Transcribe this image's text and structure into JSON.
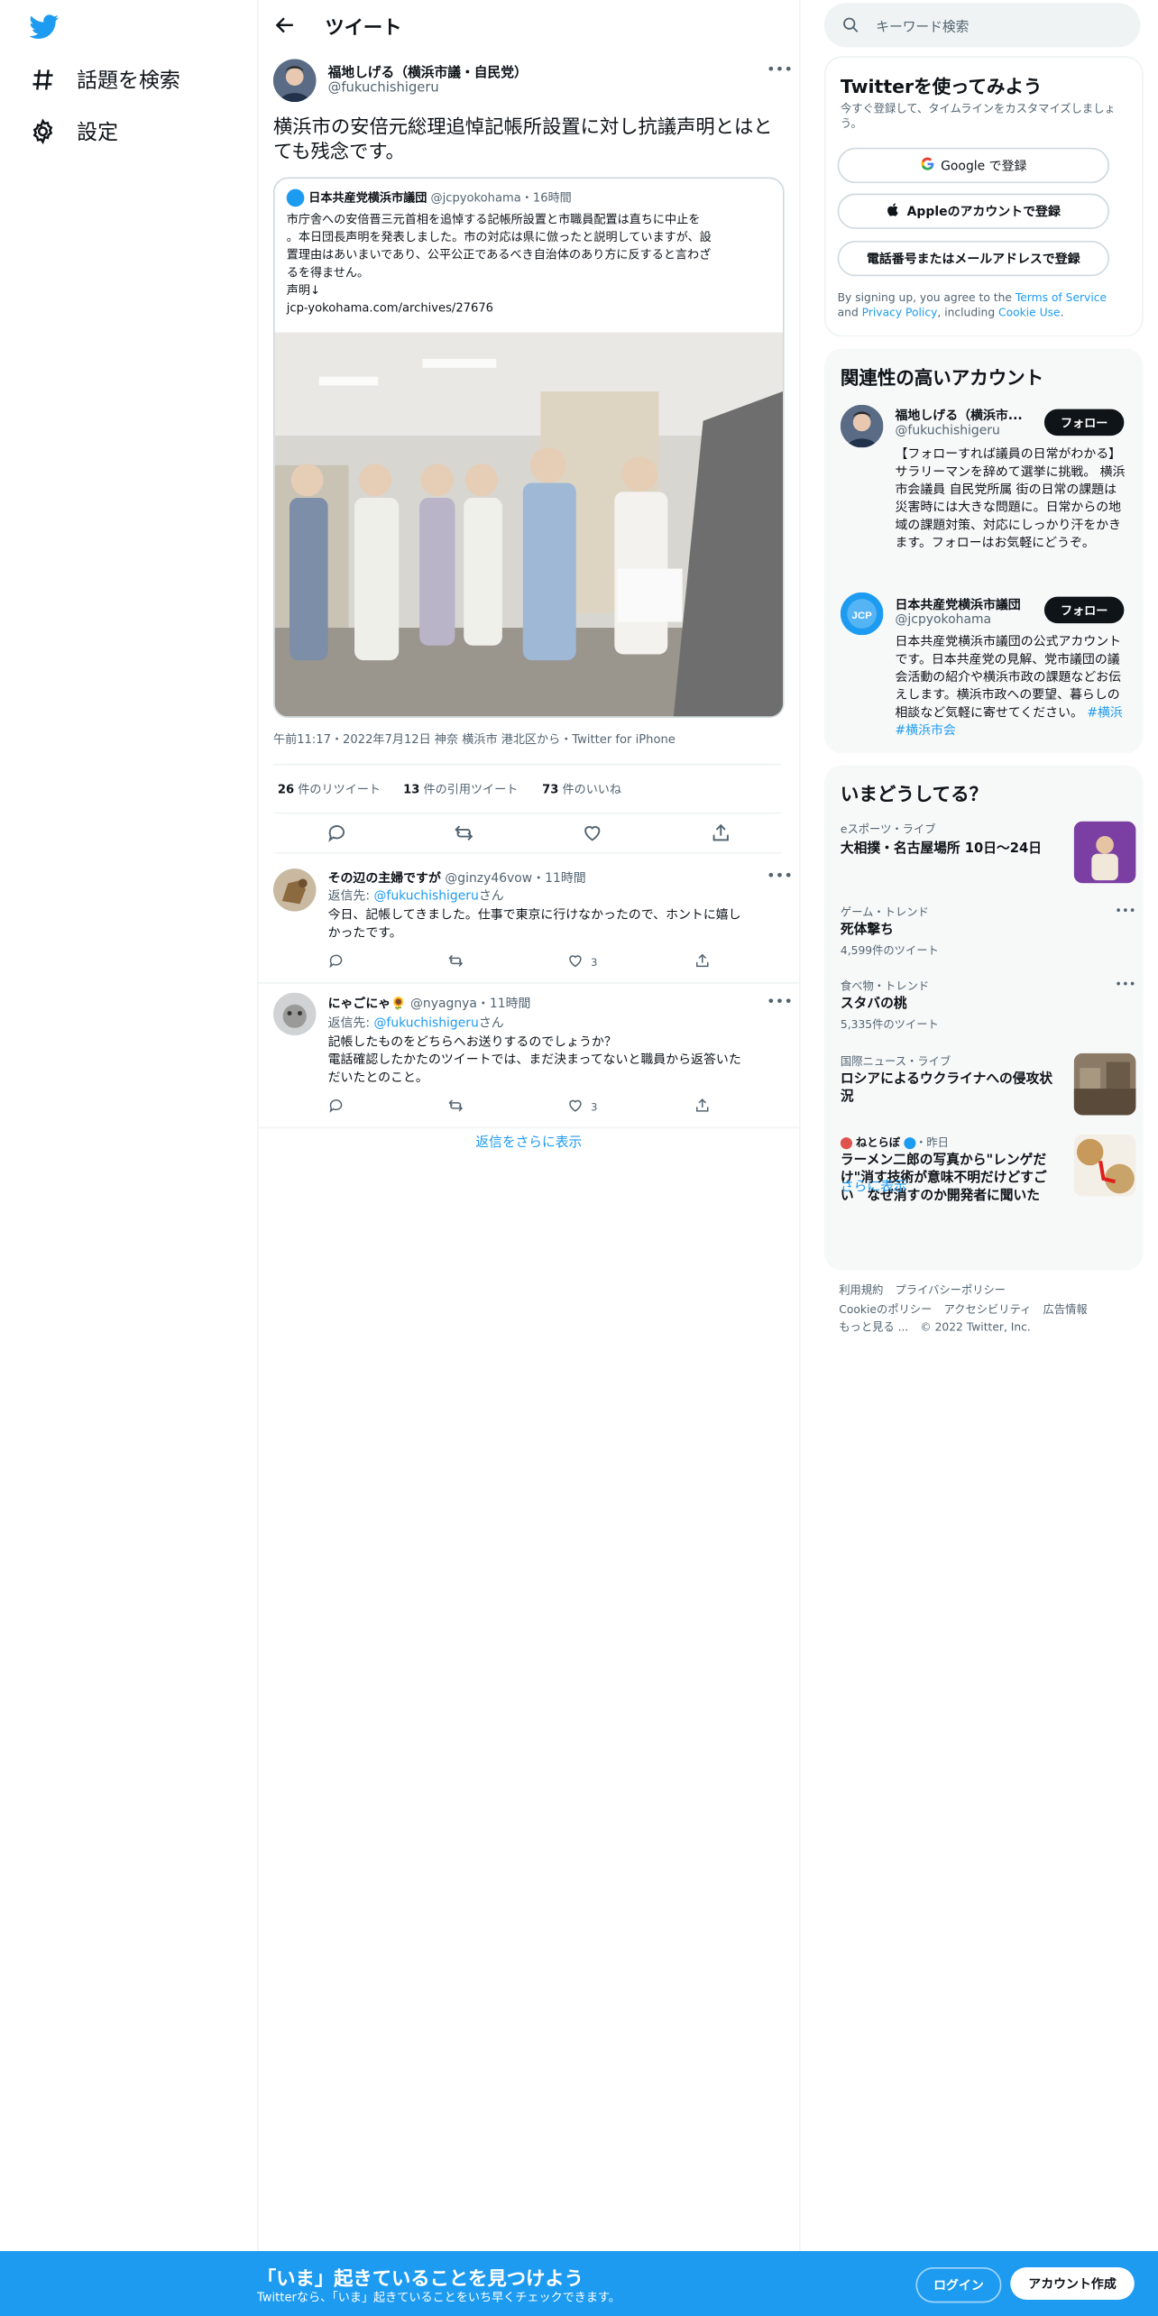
{
  "nav": {
    "explore_label": "話題を検索",
    "settings_label": "設定"
  },
  "header": {
    "title": "ツイート"
  },
  "tweet": {
    "author_name": "福地しげる（横浜市議・自民党）",
    "author_handle": "@fukuchishigeru",
    "text": "横浜市の安倍元総理追悼記帳所設置に対し抗議声明とはとても残念です。",
    "meta": "午前11:17・2022年7月12日 神奈 横浜市 港北区から・Twitter for iPhone",
    "retweets_count": "26",
    "retweets_label": "件のリツイート",
    "quotes_count": "13",
    "quotes_label": "件の引用ツイート",
    "likes_count": "73",
    "likes_label": "件のいいね"
  },
  "quote": {
    "author_name": "日本共産党横浜市議団",
    "author_handle": "@jcpyokohama",
    "time": "・16時間",
    "text_lines": [
      "市庁舎への安倍晋三元首相を追悼する記帳所設置と市職員配置は直ちに中止を",
      "。本日団長声明を発表しました。市の対応は県に倣ったと説明していますが、設",
      "置理由はあいまいであり、公平公正であるべき自治体のあり方に反すると言わざ",
      "るを得ません。",
      "声明↓",
      "jcp-yokohama.com/archives/27676"
    ]
  },
  "replies": [
    {
      "name": "その辺の主婦ですが",
      "handle": "@ginzy46vow",
      "time": "・11時間",
      "reply_prefix": "返信先: ",
      "reply_to": "@fukuchishigeru",
      "reply_suffix": "さん",
      "text_lines": [
        "今日、記帳してきました。仕事で東京に行けなかったので、ホントに嬉し",
        "かったです。"
      ],
      "likes": "3"
    },
    {
      "name": "にゃごにゃ🌻",
      "handle": "@nyagnya",
      "time": "・11時間",
      "reply_prefix": "返信先: ",
      "reply_to": "@fukuchishigeru",
      "reply_suffix": "さん",
      "text_lines": [
        "記帳したものをどちらへお送りするのでしょうか？",
        "電話確認したかたのツイートでは、まだ決まってないと職員から返答いた",
        "だいたとのこと。"
      ],
      "likes": "3"
    }
  ],
  "show_more_replies": "返信をさらに表示",
  "search": {
    "placeholder": "キーワード検索"
  },
  "signup_panel": {
    "title": "Twitterを使ってみよう",
    "desc": "今すぐ登録して、タイムラインをカスタマイズしましょう。",
    "google": "Google で登録",
    "apple": "Appleのアカウントで登録",
    "phone": "電話番号またはメールアドレスで登録",
    "legal_1": "By signing up, you agree to the ",
    "tos": "Terms of Service",
    "legal_2": " and ",
    "privacy": "Privacy Policy",
    "legal_3": ", including ",
    "cookie": "Cookie Use",
    "legal_4": "."
  },
  "related": {
    "title": "関連性の高いアカウント",
    "accounts": [
      {
        "name": "福地しげる（横浜市...",
        "handle": "@fukuchishigeru",
        "follow": "フォロー",
        "bio": "【フォローすれば議員の日常がわかる】サラリーマンを辞めて選挙に挑戦。 横浜市会議員 自民党所属 街の日常の課題は災害時には大きな問題に。日常からの地域の課題対策、対応にしっかり汗をかきます。フォローはお気軽にどうぞ。"
      },
      {
        "name": "日本共産党横浜市議団",
        "handle": "@jcpyokohama",
        "follow": "フォロー",
        "bio": "日本共産党横浜市議団の公式アカウントです。日本共産党の見解、党市議団の議会活動の紹介や横浜市政の課題などお伝えします。横浜市政への要望、暮らしの相談など気軽に寄せてください。",
        "tag1": "#横浜",
        "tag2": "#横浜市会"
      }
    ]
  },
  "trends": {
    "title": "いまどうしてる？",
    "items": [
      {
        "category": "eスポーツ・ライブ",
        "title": "大相撲・名古屋場所 10日〜24日"
      },
      {
        "category": "ゲーム・トレンド",
        "title": "死体撃ち",
        "count": "4,599件のツイート"
      },
      {
        "category": "食べ物・トレンド",
        "title": "スタバの桃",
        "count": "5,335件のツイート"
      },
      {
        "category": "国際ニュース・ライブ",
        "title": "ロシアによるウクライナへの侵攻状況"
      },
      {
        "category_name": "ねとらぼ",
        "category_time": "・昨日",
        "title": "ラーメン二郎の写真から\"レンゲだけ\"消す技術が意味不明だけどすごい　なぜ消すのか開発者に聞いた"
      }
    ],
    "show_more": "さらに表示"
  },
  "footer": {
    "links": [
      "利用規約",
      "プライバシーポリシー",
      "Cookieのポリシー",
      "アクセシビリティ",
      "広告情報",
      "もっと見る ...",
      "© 2022 Twitter, Inc."
    ]
  },
  "bottom_bar": {
    "title": "「いま」起きていることを見つけよう",
    "subtitle": "Twitterなら、「いま」起きていることをいち早くチェックできます。",
    "login": "ログイン",
    "signup": "アカウント作成"
  },
  "colors": {
    "accent": "#1d9bf0",
    "text": "#0f1419",
    "muted": "#536471"
  }
}
